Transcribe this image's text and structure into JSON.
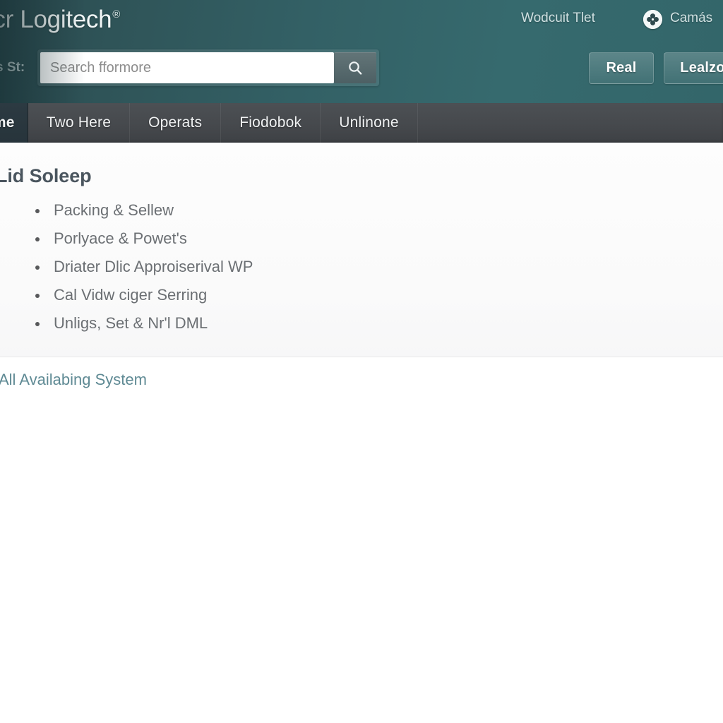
{
  "header": {
    "brand": "ificr Logitech",
    "brand_symbol": "®",
    "util_links": [
      {
        "label": "Wodcuit Tlet"
      },
      {
        "label": "Camás"
      }
    ],
    "badge_icon": "clover-badge-icon",
    "search_prefix": "s St:",
    "search": {
      "value": "",
      "placeholder": "Search fformore",
      "button_icon": "search-icon"
    },
    "buttons": [
      {
        "label": "Real"
      },
      {
        "label": "Lealzo"
      }
    ],
    "colors": {
      "gradient_start": "#2b4b50",
      "gradient_end": "#33666a",
      "search_button": "#5a6d70"
    }
  },
  "tabs": [
    {
      "label": "ame",
      "active": true
    },
    {
      "label": "Two Here",
      "active": false
    },
    {
      "label": "Operats",
      "active": false
    },
    {
      "label": "Fiodobok",
      "active": false
    },
    {
      "label": "Unlinone",
      "active": false
    }
  ],
  "tabbar_colors": {
    "bar": "#46494d",
    "active_tab": "#2a3840"
  },
  "main": {
    "section_title": "Lid Soleep",
    "bullets": [
      "Packing & Sellew",
      "Porlyace & Powet's",
      "Driater Dlic Approiserival WP",
      "Cal Vidw ciger Serring",
      "Unligs, Set & Nr'l DML"
    ],
    "footer_link": "All Availabing System",
    "link_color": "#5f8a94",
    "title_color": "#4a555e",
    "bullet_text_color": "#6b6f73"
  }
}
